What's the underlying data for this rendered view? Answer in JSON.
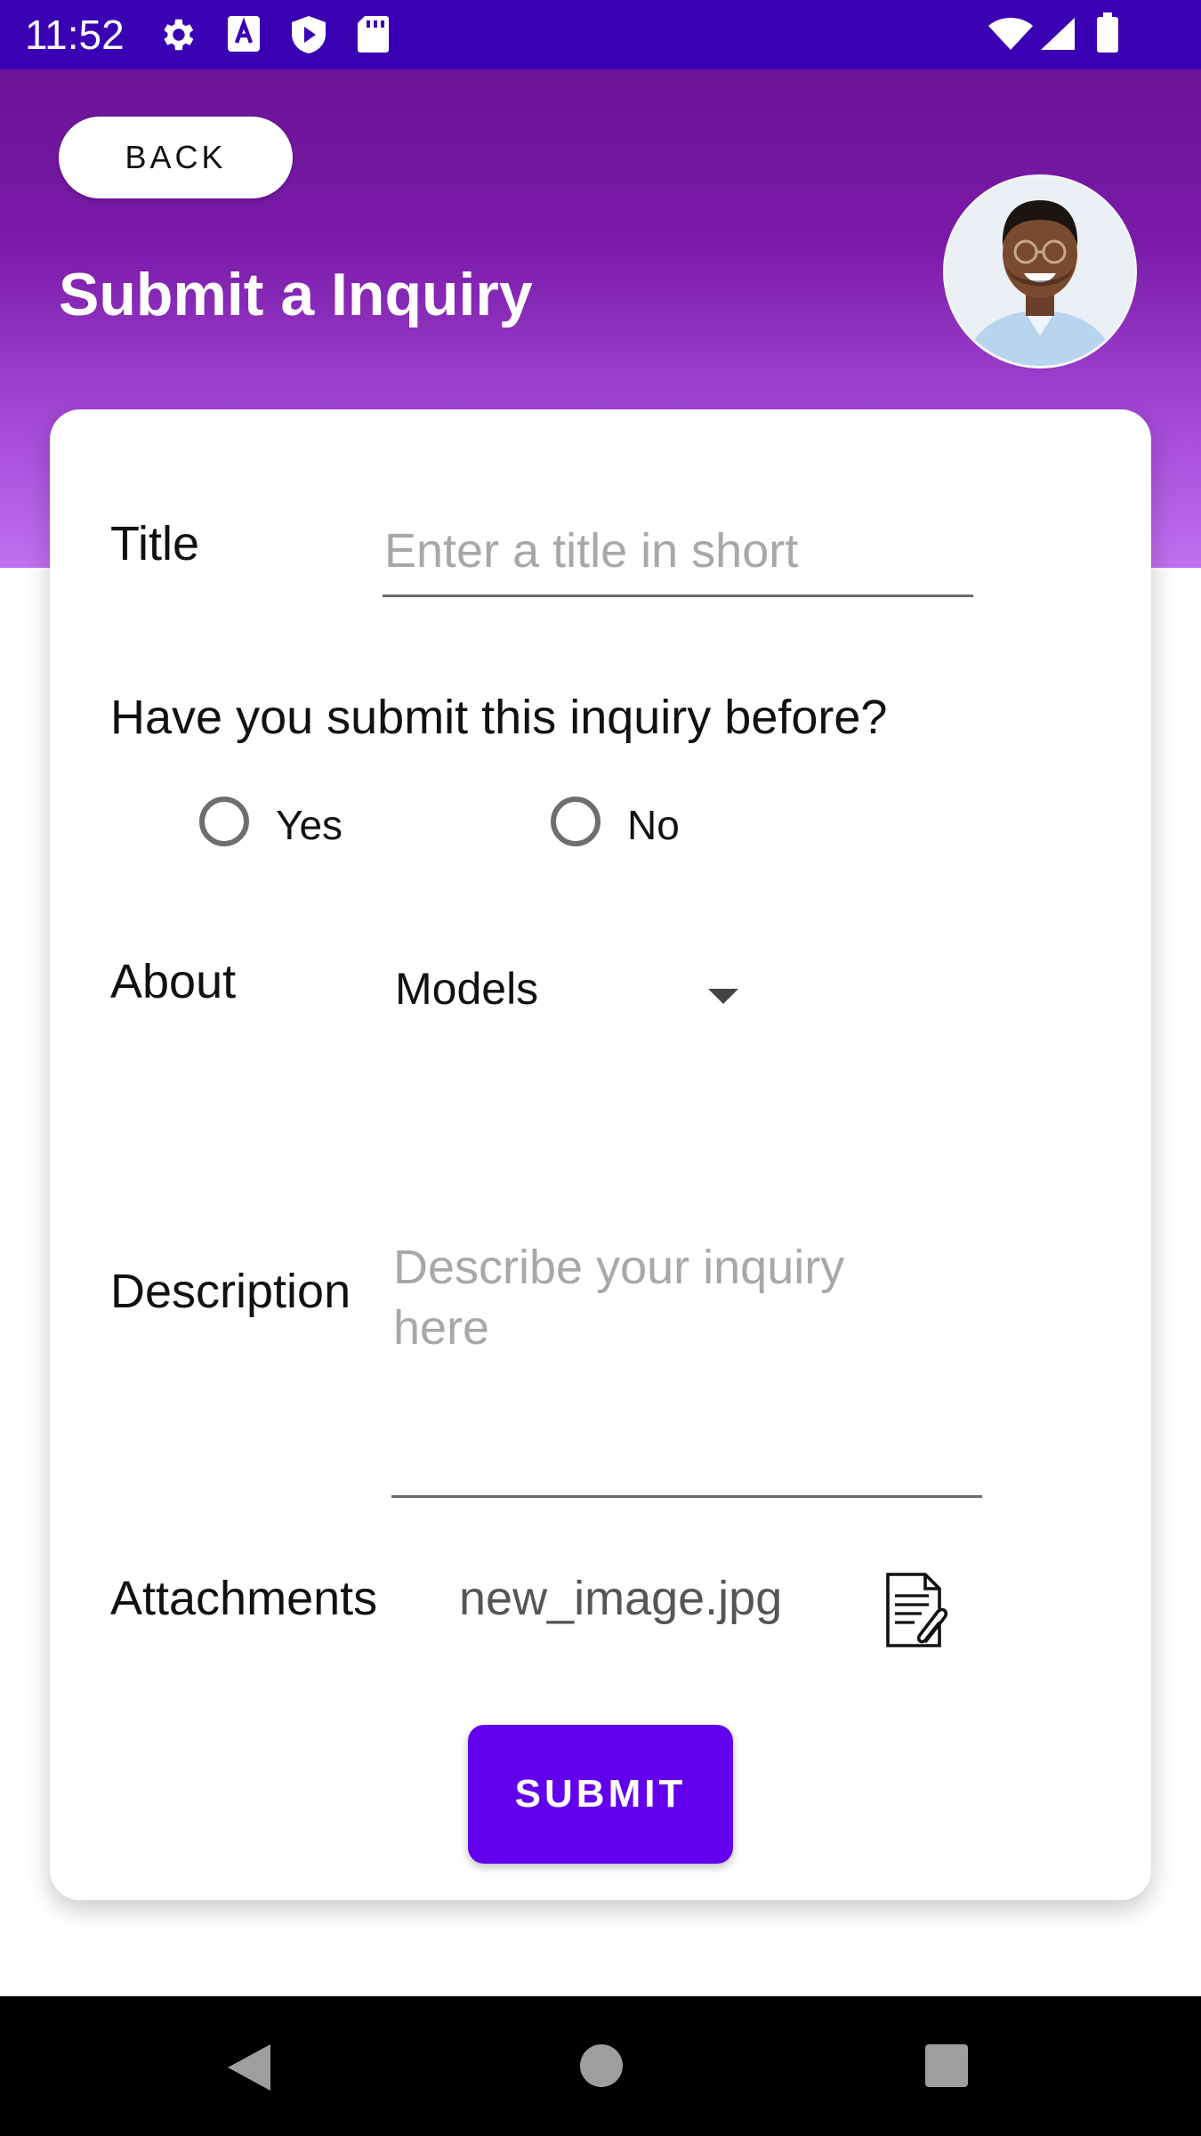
{
  "status_bar": {
    "time": "11:52",
    "icons_left": [
      "gear-icon",
      "font-a-icon",
      "shield-play-icon",
      "sd-card-icon"
    ],
    "icons_right": [
      "wifi-icon",
      "signal-icon",
      "battery-icon"
    ]
  },
  "header": {
    "back_label": "BACK",
    "title": "Submit a Inquiry",
    "gradient_top": "#6a1497",
    "gradient_bottom": "#c070f0"
  },
  "form": {
    "title_label": "Title",
    "title_placeholder": "Enter a title in short",
    "question": "Have you submit this inquiry before?",
    "radio_yes": "Yes",
    "radio_no": "No",
    "about_label": "About",
    "about_value": "Models",
    "description_label": "Description",
    "description_placeholder": "Describe your inquiry here",
    "attachments_label": "Attachments",
    "attachment_name": "new_image.jpg",
    "submit_label": "SUBMIT"
  },
  "colors": {
    "status_bar": "#3a00b4",
    "accent": "#6200ee"
  },
  "nav_bar": {
    "items": [
      "back-triangle-icon",
      "home-circle-icon",
      "recents-square-icon"
    ]
  }
}
